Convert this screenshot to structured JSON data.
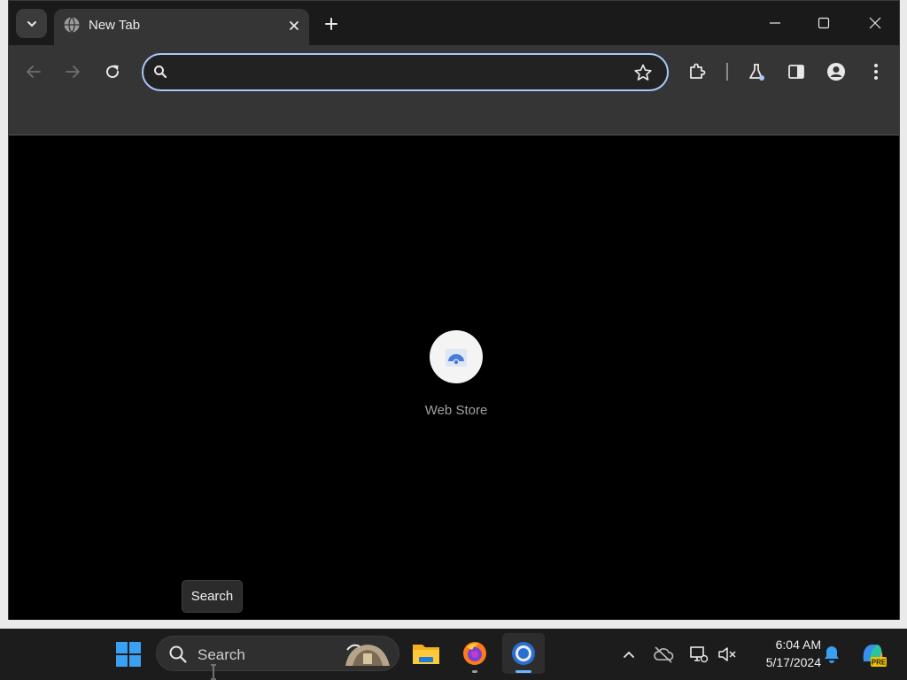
{
  "browser": {
    "tab": {
      "title": "New Tab"
    },
    "omnibox": {
      "value": "",
      "placeholder": ""
    }
  },
  "new_tab_page": {
    "shortcut": {
      "label": "Web Store"
    }
  },
  "tooltip": {
    "text": "Search"
  },
  "taskbar": {
    "search": {
      "label": "Search"
    },
    "apps": [
      {
        "name": "File Explorer",
        "icon": "file-explorer-icon"
      },
      {
        "name": "Firefox",
        "icon": "firefox-icon"
      },
      {
        "name": "Chrome",
        "icon": "chrome-icon",
        "active": true
      }
    ],
    "clock": {
      "time": "6:04 AM",
      "date": "5/17/2024"
    },
    "copilot_badge": "PRE"
  },
  "colors": {
    "accent": "#a8c7fa",
    "tab_active": "#353535",
    "titlebar": "#1a1a1a",
    "taskbar": "#1c1c1c",
    "windows_blue": "#3aa0f2"
  }
}
